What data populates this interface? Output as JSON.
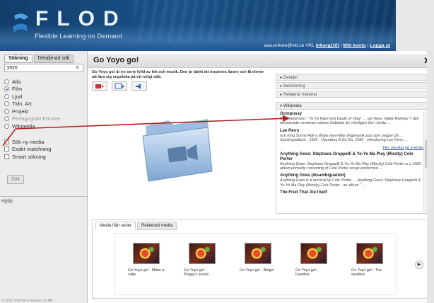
{
  "header": {
    "logo_text": "FLOD",
    "logo_subtitle": "Flexible Learning on Demand",
    "user": "asa.eriksle@vkl.se",
    "org": "VKL",
    "links": [
      "Inkorg(10)",
      "Mitt konto",
      "Logga ut"
    ],
    "colors": {
      "primary": "#1a5289",
      "accent": "#c62f2f"
    }
  },
  "sidebar": {
    "tabs": [
      "Sökning",
      "Detaljerad sök"
    ],
    "search_value": "yoyo",
    "clear_icon": "close-icon",
    "options": [
      "Alla",
      "Film",
      "Ljud",
      "Tidn. Art.",
      "Projekt",
      "Pedagogiskt Forsiter",
      "Wikipedia"
    ],
    "selected_option": "Film",
    "checkboxes": [
      "Sök ny media",
      "Exakt matchning",
      "Smart sökning"
    ],
    "search_button": "Sök",
    "help": "Hjälp",
    "footer": "© 2011 Informera Europe Ltd AB"
  },
  "main": {
    "title": "Go Yoyo go!",
    "close": "✕",
    "description": "Go Yoyo go! är en serie fylld av lek och musik. Den är tänkt att inspirera lärare och få elever att lära sig engelska på ett roligt sätt.",
    "accordion": [
      "Detaljer",
      "Beskrivning",
      "Relaterat material"
    ],
    "wiki_heading": "Wikipedia",
    "wiki_items": [
      {
        "title": "Octopussy",
        "text": "Originalversion: \"Yo-Yo Fight and Death of Vijay\" ... uk/ Nene Valley Railway \"I den remastrade versionen stavas Gobinda fel, nämligen Go r binda. ..."
      },
      {
        "title": "Lee Perry",
        "text": "och King Sunny Adé a långa yoyo-låtar (ingenarak pop som bygger på ... Samlingsalbum : 1995 · Upsetters A Go Go. 1996 · Introducing Lee Perry ..."
      },
      {
        "title": "Anything Goes: Stephane Grappelli & Yo-Yo Ma Play (Mostly) Cole Porter",
        "text": "Anything Goes: Stephane Grappelli & Yo-Yo Ma Play (Mostly) Cole Porter is a 1989 album primarily consisting of Cole Porter songs performed ..."
      },
      {
        "title": "Anything Goes (disambiguation)",
        "text": "Anything Goes is a musical by Cole Porter. ... Anything Goes: Stephane Grappelli & Yo-Yo Ma Play (Mostly) Cole Porter , an album \" ..."
      },
      {
        "title": "The Fruit That Ate Itself",
        "text": ""
      }
    ],
    "more_results": "Fler resultat på svenska",
    "media_tabs": [
      "Media från serier",
      "Relaterad media"
    ],
    "media_cards": [
      "Go Yoyo go! : Make a cake",
      "Go Yoyo go! : Peggy's nones",
      "Go Yoyo go! : Bingo!",
      "Go Yoyo go! : Families",
      "Go Yoyo go! : The weather"
    ]
  }
}
